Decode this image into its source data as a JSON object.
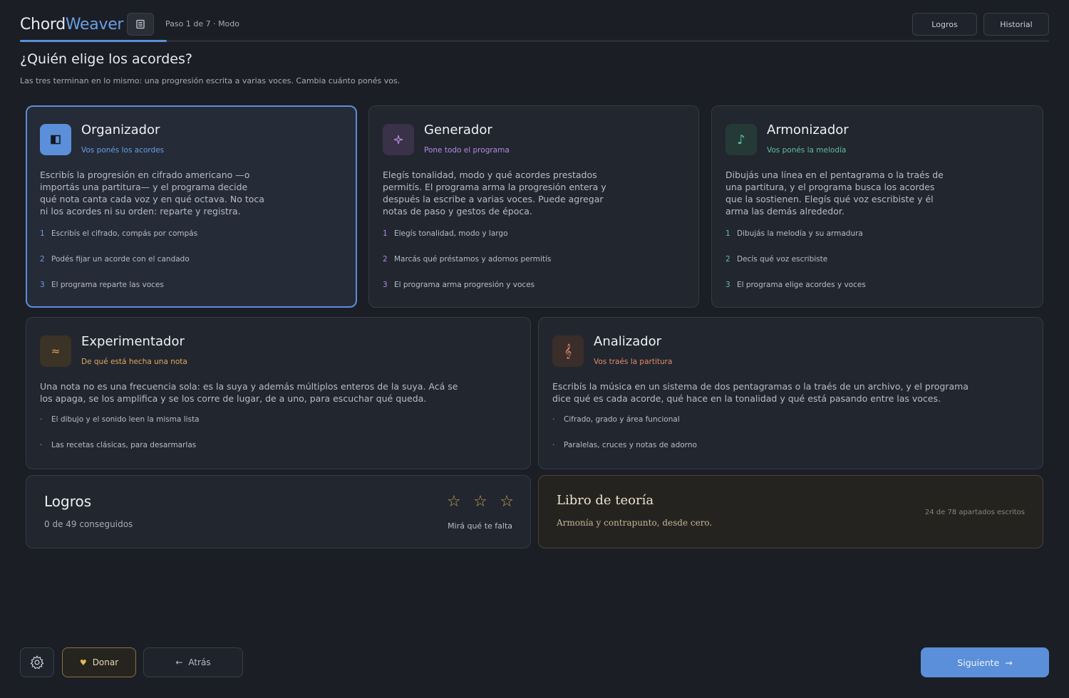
{
  "header": {
    "brand_part1": "Chord",
    "brand_part2": "Weaver",
    "doc_icon": "document-icon",
    "step_text": "Paso 1 de 7 · Modo",
    "achievements_label": "Logros",
    "history_label": "Historial",
    "progress_fraction": 0.143
  },
  "page": {
    "title": "¿Quién elige los acordes?",
    "subtitle": "Las tres terminan en lo mismo: una progresión escrita a varias voces. Cambia cuánto ponés vos."
  },
  "modes": [
    {
      "title": "Organizador",
      "tag": "Vos ponés los acordes",
      "icon": "panel-icon",
      "accent": "#6a9ee6",
      "desc": [
        "Escribís la progresión en cifrado americano —o",
        "importás una partitura— y el programa decide",
        "qué nota canta cada voz y en qué octava. No toca",
        "ni los acordes ni su orden: reparte y registra."
      ],
      "steps": [
        "Escribís el cifrado, compás por compás",
        "Podés fijar un acorde con el candado",
        "El programa reparte las voces"
      ]
    },
    {
      "title": "Generador",
      "tag": "Pone todo el programa",
      "icon": "sparkle-icon",
      "accent": "#b58ae0",
      "desc": [
        "Elegís tonalidad, modo y qué acordes prestados",
        "permitís. El programa arma la progresión entera y",
        "después la escribe a varias voces. Puede agregar",
        "notas de paso y gestos de época."
      ],
      "steps": [
        "Elegís tonalidad, modo y largo",
        "Marcás qué préstamos y adornos permitís",
        "El programa arma progresión y voces"
      ]
    },
    {
      "title": "Armonizador",
      "tag": "Vos ponés la melodía",
      "icon": "music-note-icon",
      "accent": "#5fbf9f",
      "desc": [
        "Dibujás una línea en el pentagrama o la traés de",
        "una partitura, y el programa busca los acordes",
        "que la sostienen. Elegís qué voz escribiste y él",
        "arma las demás alrededor."
      ],
      "steps": [
        "Dibujás la melodía y su armadura",
        "Decís qué voz escribiste",
        "El programa elige acordes y voces"
      ]
    },
    {
      "title": "Experimentador",
      "tag": "De qué está hecha una nota",
      "icon": "wave-icon",
      "accent": "#e0a85a",
      "desc": [
        "Una nota no es una frecuencia sola: es la suya y además múltiplos enteros de la suya. Acá se",
        "los apaga, se los amplifica y se los corre de lugar, de a uno, para escuchar qué queda."
      ],
      "steps": [
        "El dibujo y el sonido leen la misma lista",
        "Las recetas clásicas, para desarmarlas"
      ]
    },
    {
      "title": "Analizador",
      "tag": "Vos traés la partitura",
      "icon": "treble-clef-icon",
      "accent": "#e08a6a",
      "desc": [
        "Escribís la música en un sistema de dos pentagramas o la traés de un archivo, y el programa",
        "dice qué es cada acorde, qué hace en la tonalidad y qué está pasando entre las voces."
      ],
      "steps": [
        "Cifrado, grado y área funcional",
        "Paralelas, cruces y notas de adorno"
      ]
    }
  ],
  "achievements_card": {
    "title": "Logros",
    "count": "0 de 49 conseguidos",
    "stars_earned": 0,
    "stars_total": 3,
    "link": "Mirá qué te falta"
  },
  "book_card": {
    "title": "Libro de teoría",
    "subtitle": "Armonía y contrapunto, desde cero.",
    "progress": "24 de 78 apartados escritos"
  },
  "footer": {
    "settings_icon": "gear-icon",
    "donate_label": "Donar",
    "back_label": "Atrás",
    "next_label": "Siguiente"
  }
}
